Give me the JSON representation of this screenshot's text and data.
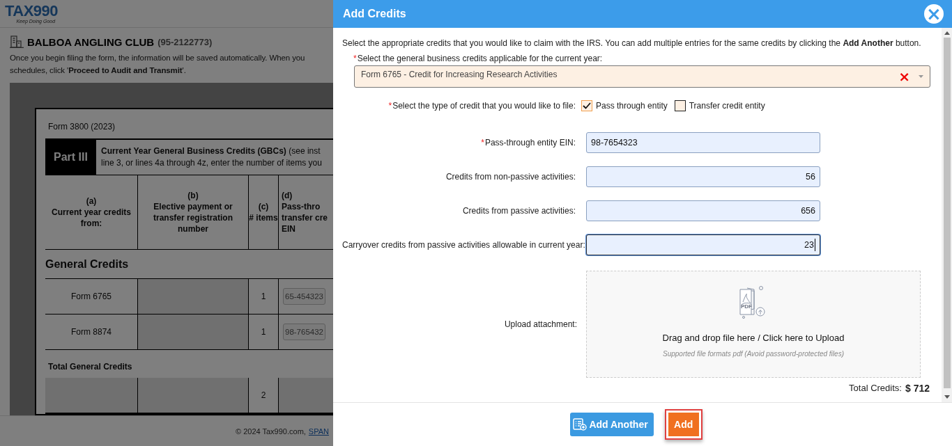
{
  "app": {
    "logo": "TAX990",
    "tagline": "Keep Doing Good",
    "org_name": "BALBOA ANGLING CLUB",
    "org_ein": "(95-2122773)",
    "intro_lines": [
      "Once you begin filing the form, the information will be saved automatically. When you",
      "schedules, click '**Proceed to Audit and Transmit**'."
    ]
  },
  "form": {
    "title": "Form 3800 (2023)",
    "part": "Part III",
    "part_title_lines": [
      "**Current Year General Business Credits (GBCs)** (see inst",
      "line 3, or lines 4a through 4z, enter the number of items you"
    ],
    "columns": [
      {
        "letter": "(a)",
        "label": "Current year credits from:"
      },
      {
        "letter": "(b)",
        "label": "Elective payment or transfer registration number"
      },
      {
        "letter": "(c)",
        "label": "# items"
      },
      {
        "letter": "(d)",
        "label": "Pass-thro transfer cre EIN"
      }
    ],
    "section": "General Credits",
    "rows": [
      {
        "credit": "Form 6765",
        "items": "1",
        "ein": "65-454323"
      },
      {
        "credit": "Form 8874",
        "items": "1",
        "ein": "98-765432"
      }
    ],
    "total_label": "Total General Credits",
    "total_items": "2"
  },
  "footer": {
    "copyright": "© 2024 Tax990.com,",
    "link": "SPAN"
  },
  "modal": {
    "title": "Add Credits",
    "close": "×",
    "intro": "Select the appropriate credits that you would like to claim with the IRS. You can add multiple entries for the same credits by clicking the **Add Another** button.",
    "credit_select": {
      "mark": "*",
      "label": "Select the general business credits applicable for the current year:",
      "value": "Form 6765 - Credit for Increasing Research Activities",
      "clear": "×"
    },
    "credit_type": {
      "mark": "*",
      "label": "Select the type of credit that you would like to file:",
      "options": [
        {
          "label": "Pass through entity",
          "checked": true
        },
        {
          "label": "Transfer credit entity",
          "checked": false
        }
      ]
    },
    "fields": [
      {
        "mark": "*",
        "label": "Pass-through entity EIN:",
        "value": "98-7654323",
        "kind": "text",
        "focused": false
      },
      {
        "label": "Credits from non-passive activities:",
        "value": "56",
        "kind": "amount",
        "focused": false
      },
      {
        "label": "Credits from passive activities:",
        "value": "656",
        "kind": "amount",
        "focused": false
      },
      {
        "label": "Carryover credits from passive activities allowable in current year:",
        "value": "23",
        "kind": "amount",
        "focused": true
      }
    ],
    "upload": {
      "label": "Upload attachment:",
      "prompt": "Drag and drop file here / Click here to Upload",
      "hint": "Supported file formats pdf (Avoid password-protected files)",
      "icon_text": "PDF"
    },
    "total": {
      "label": "Total Credits:",
      "value": "$ 712"
    },
    "buttons": [
      {
        "label": "Add Another",
        "kind": "secondary",
        "focused": false
      },
      {
        "label": "Add",
        "kind": "primary",
        "focused": true
      }
    ]
  }
}
